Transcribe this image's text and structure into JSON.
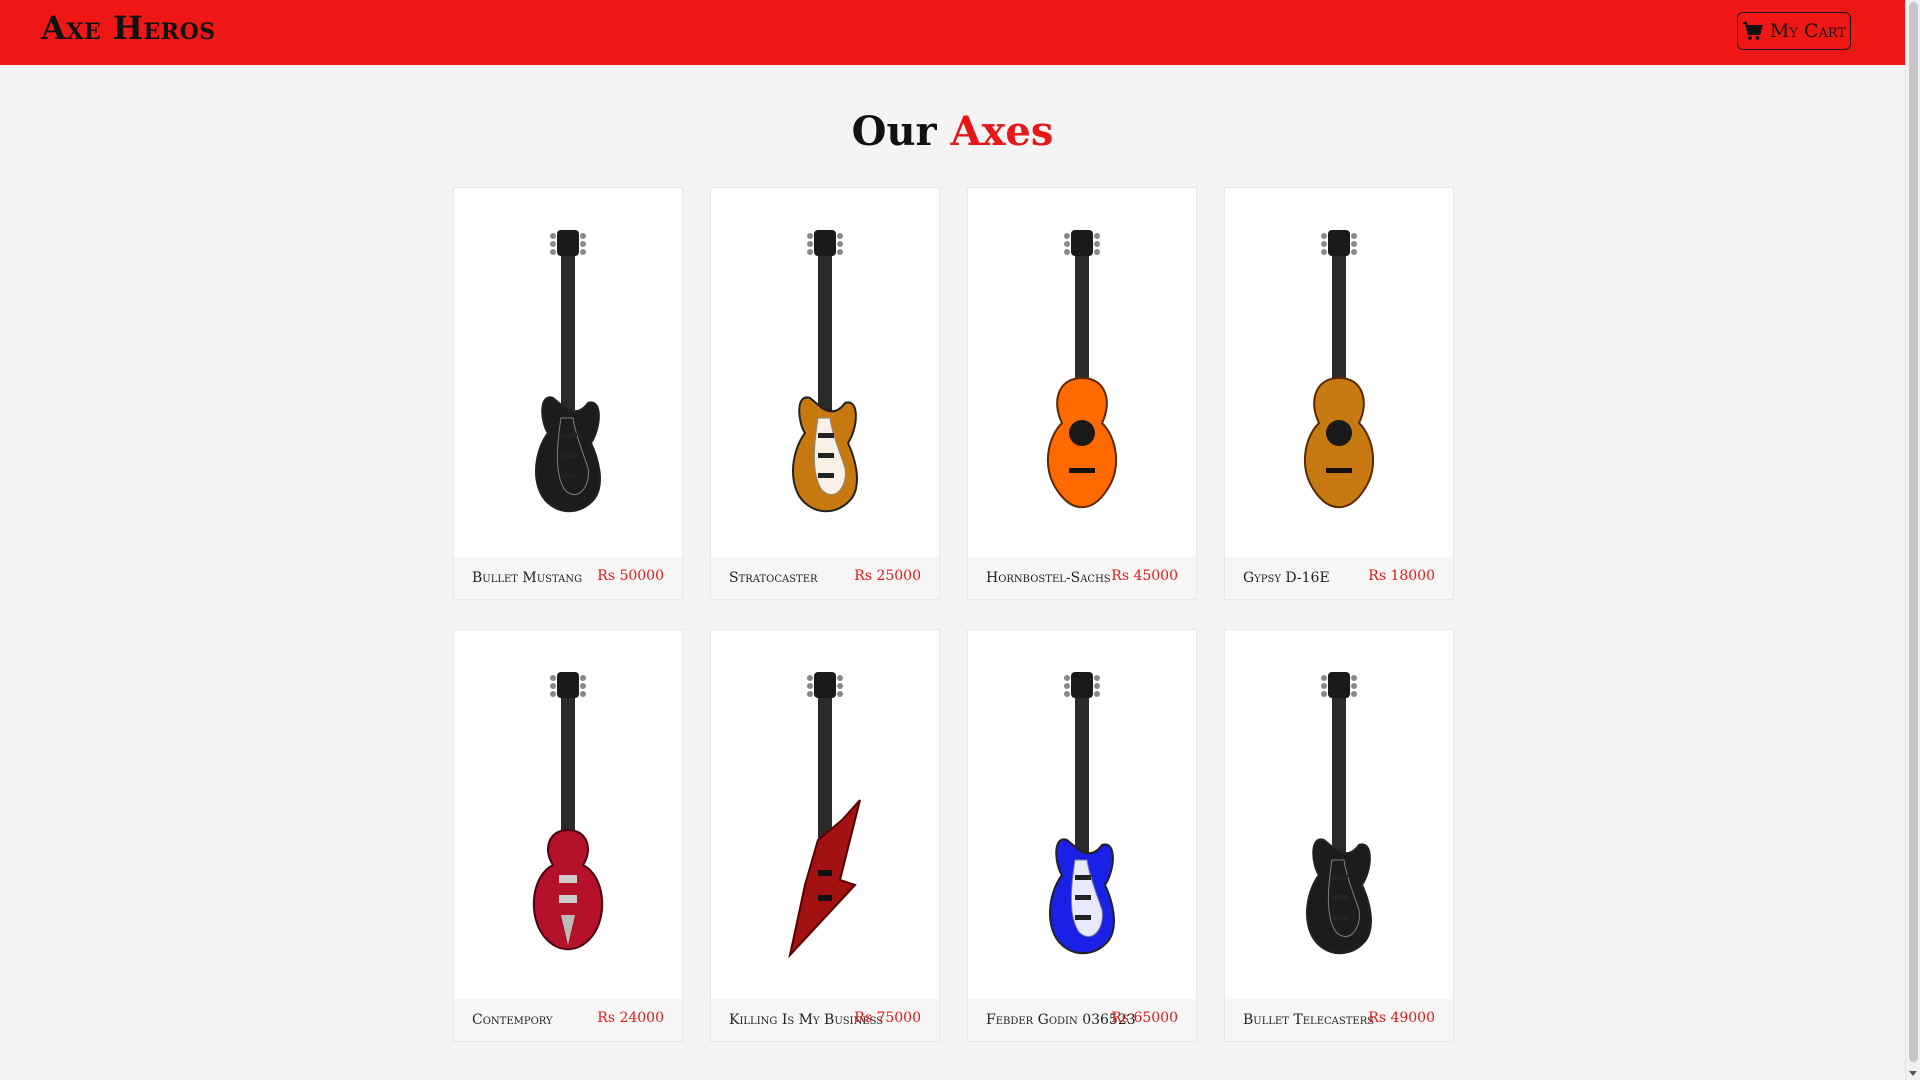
{
  "navbar": {
    "brand": "Axe Heros",
    "cart_label": "My Cart",
    "brand_color": "#ef1616"
  },
  "heading": {
    "main": "Our",
    "accent": "Axes"
  },
  "products": [
    {
      "name": "Bullet Mustang",
      "price": "Rs 50000",
      "icon": "electric-guitar-black-icon",
      "body": "#1c1c1c",
      "guard": "#1c1c1c"
    },
    {
      "name": "Stratocaster",
      "price": "Rs 25000",
      "icon": "electric-guitar-sunburst-icon",
      "body": "#c7780e",
      "guard": "#ffffff"
    },
    {
      "name": "Hornbostel-Sachs",
      "price": "Rs 45000",
      "icon": "acoustic-guitar-orange-icon",
      "body": "#ff6a00",
      "guard": "#ff6a00"
    },
    {
      "name": "Gypsy D-16E",
      "price": "Rs 18000",
      "icon": "acoustic-guitar-sunburst-icon",
      "body": "#c77a12",
      "guard": "#c77a12"
    },
    {
      "name": "Contempory",
      "price": "Rs 24000",
      "icon": "hollow-guitar-red-icon",
      "body": "#b3122a",
      "guard": "#b3122a"
    },
    {
      "name": "Killing Is My Business",
      "price": "Rs 75000",
      "icon": "explorer-guitar-red-icon",
      "body": "#a31212",
      "guard": "#a31212"
    },
    {
      "name": "Febder Godin 036523",
      "price": "Rs 65000",
      "icon": "electric-guitar-blue-icon",
      "body": "#1a20e6",
      "guard": "#ffffff"
    },
    {
      "name": "Bullet Telecasters",
      "price": "Rs 49000",
      "icon": "electric-guitar-black-icon",
      "body": "#1c1c1c",
      "guard": "#1c1c1c"
    }
  ]
}
